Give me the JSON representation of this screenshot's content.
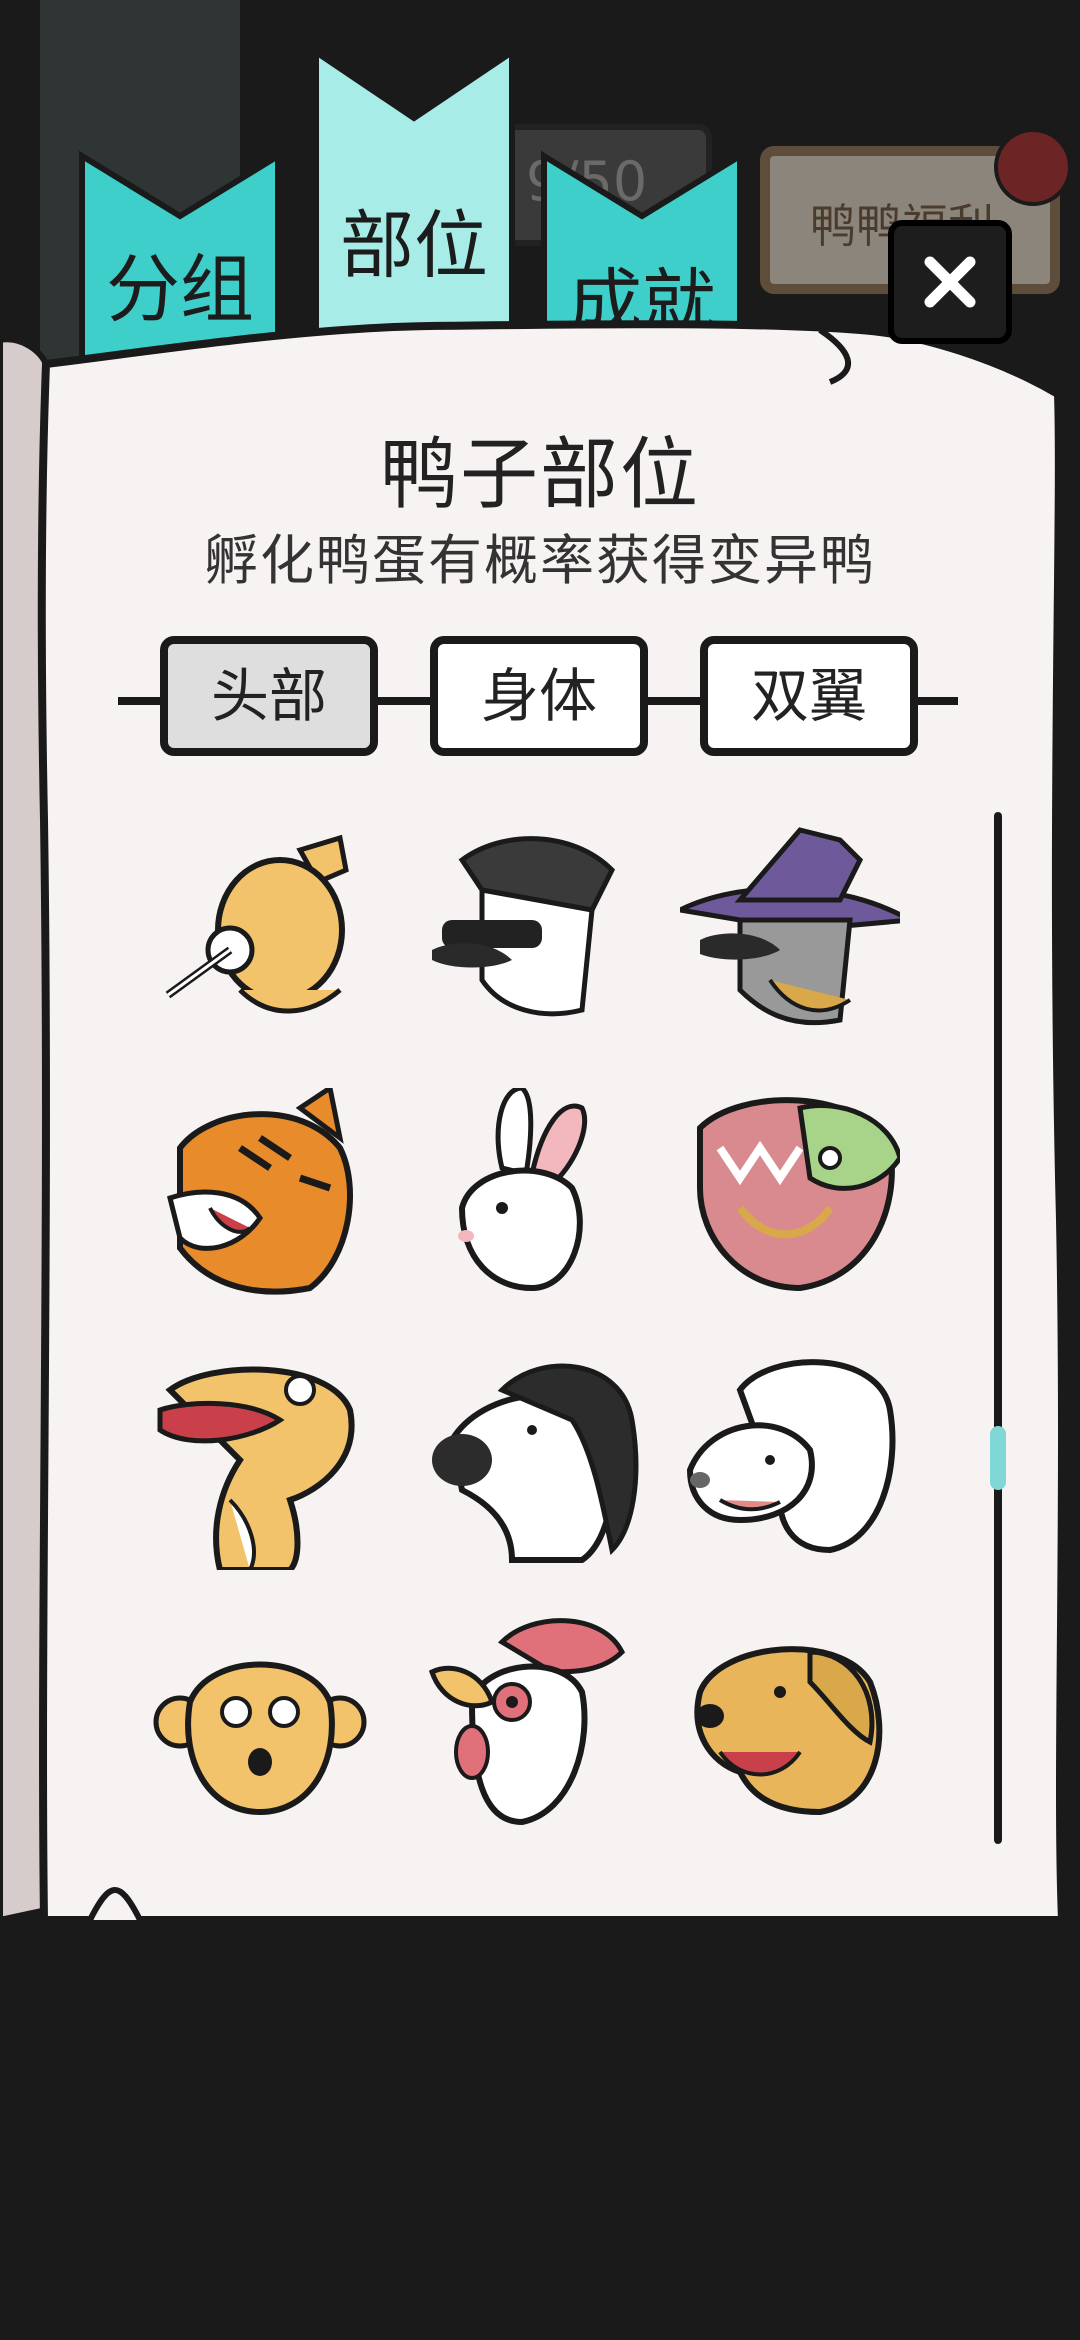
{
  "tabs": [
    {
      "label": "分组"
    },
    {
      "label": "部位"
    },
    {
      "label": "成就"
    }
  ],
  "background": {
    "welfare_label": "鸭鸭福利",
    "counter_text": "9/50"
  },
  "close_label": "×",
  "book": {
    "title": "鸭子部位",
    "subtitle": "孵化鸭蛋有概率获得变异鸭"
  },
  "segments": [
    {
      "label": "头部",
      "active": true
    },
    {
      "label": "身体",
      "active": false
    },
    {
      "label": "双翼",
      "active": false
    }
  ],
  "items": [
    {
      "name": "candy-bag-icon"
    },
    {
      "name": "punk-duck-icon"
    },
    {
      "name": "witch-icon"
    },
    {
      "name": "tiger-icon"
    },
    {
      "name": "rabbit-icon"
    },
    {
      "name": "monster-icon"
    },
    {
      "name": "snake-icon"
    },
    {
      "name": "horse-icon"
    },
    {
      "name": "sheep-icon"
    },
    {
      "name": "monkey-icon"
    },
    {
      "name": "rooster-icon"
    },
    {
      "name": "dog-icon"
    }
  ],
  "colors": {
    "tab": "#3fcfcb",
    "tab_active": "#a8ece8",
    "paper": "#f7f3f2",
    "accent_scroll": "#7fd8d6"
  }
}
